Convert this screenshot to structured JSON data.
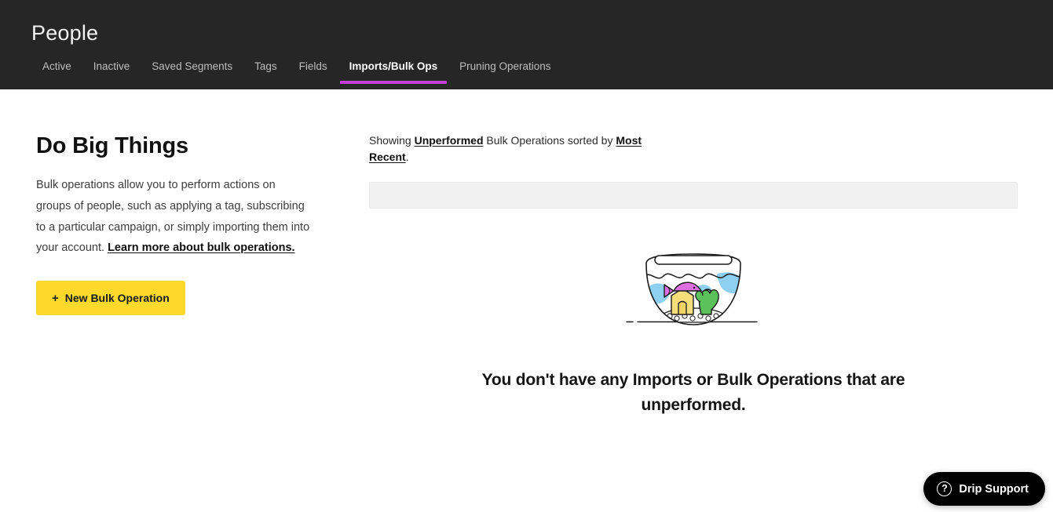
{
  "header": {
    "title": "People",
    "background_color": "#262626",
    "active_accent_color": "#c13fd6",
    "tabs": [
      {
        "label": "Active",
        "active": false
      },
      {
        "label": "Inactive",
        "active": false
      },
      {
        "label": "Saved Segments",
        "active": false
      },
      {
        "label": "Tags",
        "active": false
      },
      {
        "label": "Fields",
        "active": false
      },
      {
        "label": "Imports/Bulk Ops",
        "active": true
      },
      {
        "label": "Pruning Operations",
        "active": false
      }
    ]
  },
  "intro": {
    "heading": "Do Big Things",
    "body_before_link": "Bulk operations allow you to perform actions on groups of people, such as applying a tag, subscribing to a particular campaign, or simply importing them into your account. ",
    "link_text": "Learn more about bulk operations.",
    "button_label": "New Bulk Operation",
    "button_plus": "+",
    "button_color": "#fcd92b"
  },
  "results": {
    "showing_prefix": "Showing ",
    "filter_status": "Unperformed",
    "showing_middle": " Bulk Operations sorted by ",
    "filter_sort": "Most Recent",
    "showing_suffix": ".",
    "table_header_placeholder": ""
  },
  "empty_state": {
    "illustration": "empty-fishbowl-illustration",
    "message_line_1": "You don't have any Imports or Bulk Operations",
    "message_line_2": "that are unperformed.",
    "colors": {
      "fish": "#dd6fe0",
      "water": "#8ed0f0",
      "house": "#f5df7a",
      "plant": "#5bc25b",
      "outline": "#1a1a1a"
    }
  },
  "support": {
    "icon": "question-mark-circle-icon",
    "icon_glyph": "?",
    "label": "Drip Support",
    "background_color": "#000000"
  }
}
